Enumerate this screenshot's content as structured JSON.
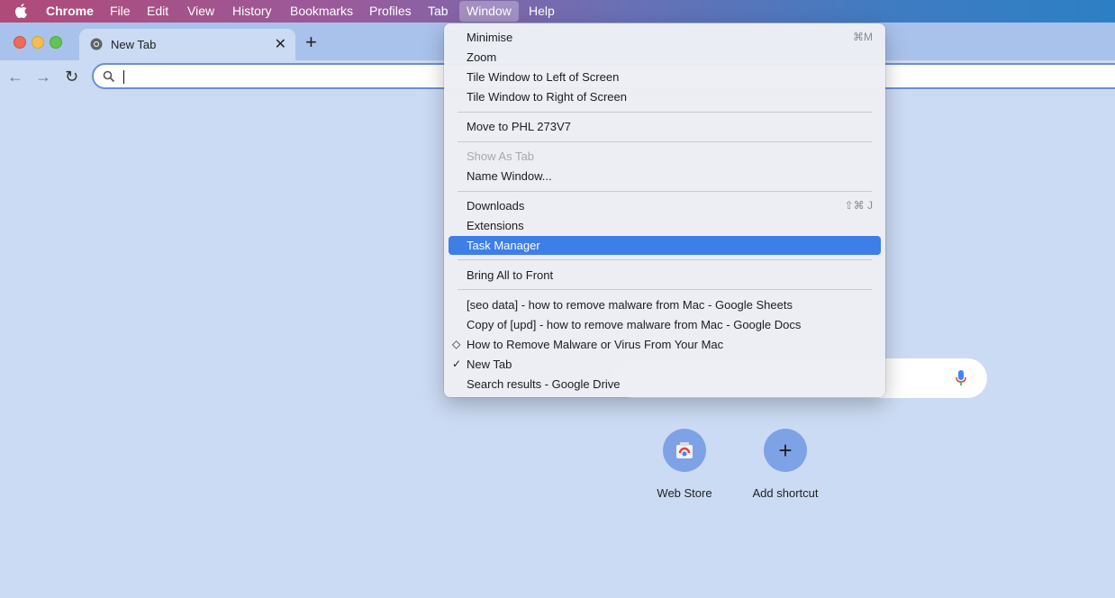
{
  "menubar": {
    "apple": "",
    "items": [
      "Chrome",
      "File",
      "Edit",
      "View",
      "History",
      "Bookmarks",
      "Profiles",
      "Tab",
      "Window",
      "Help"
    ]
  },
  "tab": {
    "title": "New Tab",
    "close": "✕",
    "new_tab": "+"
  },
  "toolbar": {
    "back": "←",
    "forward": "→",
    "reload": "↻",
    "omnibox_value": ""
  },
  "window_menu": {
    "minimise": "Minimise",
    "minimise_shortcut": "⌘M",
    "zoom": "Zoom",
    "tile_left": "Tile Window to Left of Screen",
    "tile_right": "Tile Window to Right of Screen",
    "move_to": "Move to PHL 273V7",
    "show_as_tab": "Show As Tab",
    "name_window": "Name Window...",
    "downloads": "Downloads",
    "downloads_shortcut": "⇧⌘ J",
    "extensions": "Extensions",
    "task_manager": "Task Manager",
    "bring_all": "Bring All to Front",
    "windows": [
      "[seo data] - how to remove malware from Mac - Google Sheets",
      "Copy of [upd] - how to remove malware from Mac - Google Docs",
      "How to Remove Malware or Virus From Your Mac",
      "New Tab",
      "Search results - Google Drive"
    ],
    "diamond_mark": "◇",
    "check_mark": "✓"
  },
  "shortcuts": [
    {
      "label": "Web Store"
    },
    {
      "label": "Add shortcut",
      "icon_text": "+"
    }
  ],
  "colors": {
    "accent": "#3d7ee9",
    "page_bg": "#cbdbf3"
  }
}
